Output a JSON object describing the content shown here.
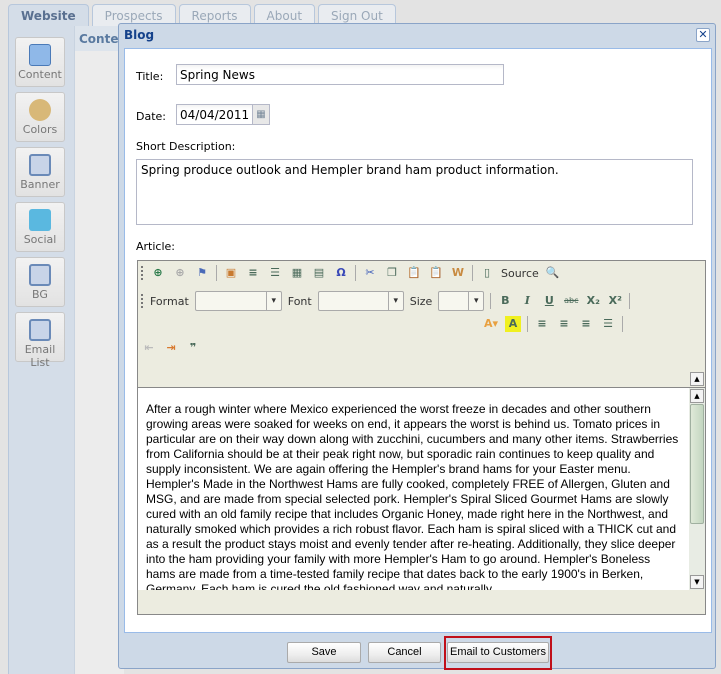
{
  "tabs": [
    "Website",
    "Prospects",
    "Reports",
    "About",
    "Sign Out"
  ],
  "sidebar": [
    {
      "label": "Content",
      "icon": "content-icon"
    },
    {
      "label": "Colors",
      "icon": "palette-icon"
    },
    {
      "label": "Banner",
      "icon": "banner-icon"
    },
    {
      "label": "Social",
      "icon": "twitter-icon"
    },
    {
      "label": "BG",
      "icon": "bg-icon"
    },
    {
      "label": "Email List",
      "icon": "email-list-icon"
    }
  ],
  "tree": {
    "header": "Content"
  },
  "dialog": {
    "title": "Blog",
    "title_label": "Title:",
    "title_value": "Spring News",
    "date_label": "Date:",
    "date_value": "04/04/2011",
    "short_label": "Short Description:",
    "short_value": "Spring produce outlook and Hempler brand ham product information.",
    "article_label": "Article:",
    "toolbar": {
      "source": "Source",
      "format": "Format",
      "font": "Font",
      "size": "Size"
    },
    "article": "After a rough winter where Mexico experienced the worst freeze in decades and other southern growing areas were soaked for weeks on end, it appears the worst is behind us. Tomato prices in particular are on their way down along with zucchini, cucumbers and many other items. Strawberries from California should be at their peak right now, but sporadic rain continues to keep quality and supply inconsistent. We are again offering the Hempler's brand hams for your Easter menu. Hempler's Made in the Northwest Hams are fully cooked, completely FREE of Allergen, Gluten and MSG, and are made from special selected pork. Hempler's Spiral Sliced Gourmet Hams are slowly cured with an old family recipe that includes Organic Honey, made right here in the Northwest, and naturally smoked which provides a rich robust flavor. Each ham is spiral sliced with a THICK cut and as a result the product stays moist and evenly tender after re-heating. Additionally, they slice deeper into the ham providing your family with more Hempler's Ham to go around. Hempler's Boneless hams are made from a time-tested family recipe that dates back to the early 1900's in Berken, Germany. Each ham is cured the old fashioned way and naturally",
    "save": "Save",
    "cancel": "Cancel",
    "email": "Email to Customers"
  },
  "colors": {
    "highlight": "#c0101a",
    "title": "#15428b"
  }
}
